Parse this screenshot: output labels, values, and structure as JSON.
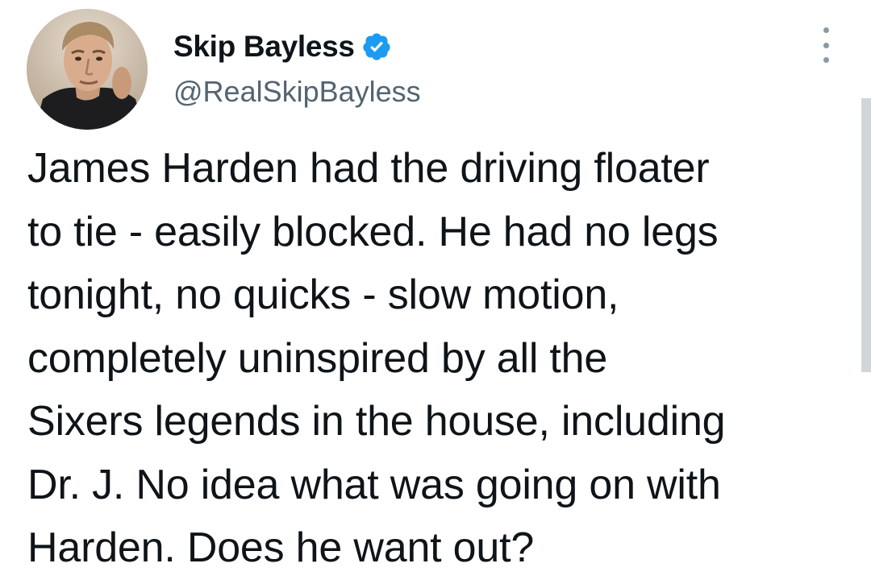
{
  "author": {
    "display_name": "Skip Bayless",
    "handle": "@RealSkipBayless",
    "verified": true,
    "avatar_icon": "profile-photo"
  },
  "tweet": {
    "lines": [
      "James Harden had the driving floater",
      "to tie - easily blocked. He had no legs",
      "tonight, no quicks - slow motion,",
      "completely uninspired by all the",
      "Sixers legends in the house, including",
      "Dr. J. No idea what was going on with",
      "Harden. Does he want out?"
    ]
  },
  "icons": {
    "verified": "verified-badge-icon",
    "more": "more-options-icon"
  },
  "colors": {
    "text_primary": "#0f1419",
    "text_secondary": "#536471",
    "verified_blue": "#1d9bf0",
    "background": "#ffffff"
  }
}
